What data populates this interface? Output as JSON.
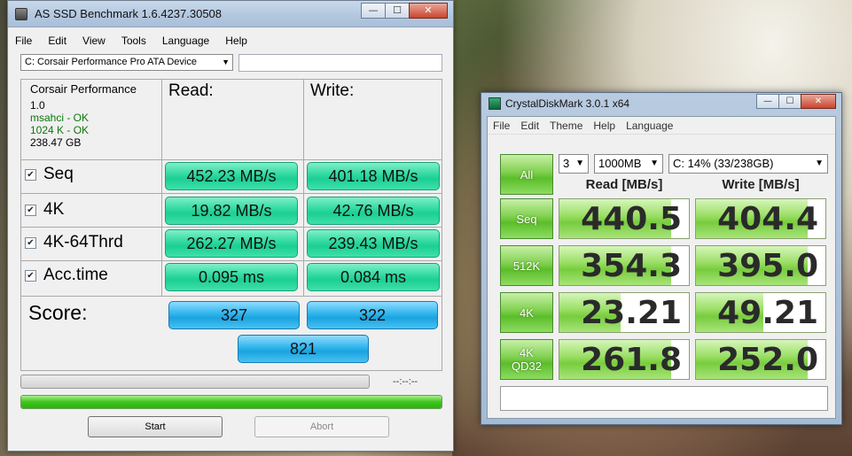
{
  "as_ssd": {
    "title": "AS SSD Benchmark 1.6.4237.30508",
    "caption": {
      "minimize": "—",
      "maximize": "☐",
      "close": "✕"
    },
    "menu": [
      "File",
      "Edit",
      "View",
      "Tools",
      "Language",
      "Help"
    ],
    "drive": "C: Corsair Performance Pro ATA Device",
    "info": {
      "name": "Corsair Performance",
      "firmware": "1.0",
      "driver": "msahci - OK",
      "alignment": "1024 K - OK",
      "size": "238.47 GB"
    },
    "headers": {
      "read": "Read:",
      "write": "Write:"
    },
    "rows": [
      {
        "label": "Seq",
        "read": "452.23 MB/s",
        "write": "401.18 MB/s"
      },
      {
        "label": "4K",
        "read": "19.82 MB/s",
        "write": "42.76 MB/s"
      },
      {
        "label": "4K-64Thrd",
        "read": "262.27 MB/s",
        "write": "239.43 MB/s"
      },
      {
        "label": "Acc.time",
        "read": "0.095 ms",
        "write": "0.084 ms"
      }
    ],
    "score_label": "Score:",
    "score": {
      "read": "327",
      "write": "322",
      "total": "821"
    },
    "time": "--:--:--",
    "progress_fraction": 1.0,
    "buttons": {
      "start": "Start",
      "abort": "Abort"
    }
  },
  "cdm": {
    "title": "CrystalDiskMark 3.0.1 x64",
    "caption": {
      "minimize": "—",
      "maximize": "☐",
      "close": "✕"
    },
    "menu": [
      "File",
      "Edit",
      "Theme",
      "Help",
      "Language"
    ],
    "all_label": "All",
    "runs": "3",
    "size": "1000MB",
    "drive": "C: 14% (33/238GB)",
    "headers": {
      "read": "Read [MB/s]",
      "write": "Write [MB/s]"
    },
    "rows": [
      {
        "label": "Seq",
        "read": "440.5",
        "write": "404.4",
        "read_fill": 0.86,
        "write_fill": 0.86
      },
      {
        "label": "512K",
        "read": "354.3",
        "write": "395.0",
        "read_fill": 0.86,
        "write_fill": 0.86
      },
      {
        "label": "4K",
        "read": "23.21",
        "write": "49.21",
        "read_fill": 0.47,
        "write_fill": 0.52
      },
      {
        "label": "4K\nQD32",
        "read": "261.8",
        "write": "252.0",
        "read_fill": 0.86,
        "write_fill": 0.86
      }
    ],
    "comment": ""
  }
}
